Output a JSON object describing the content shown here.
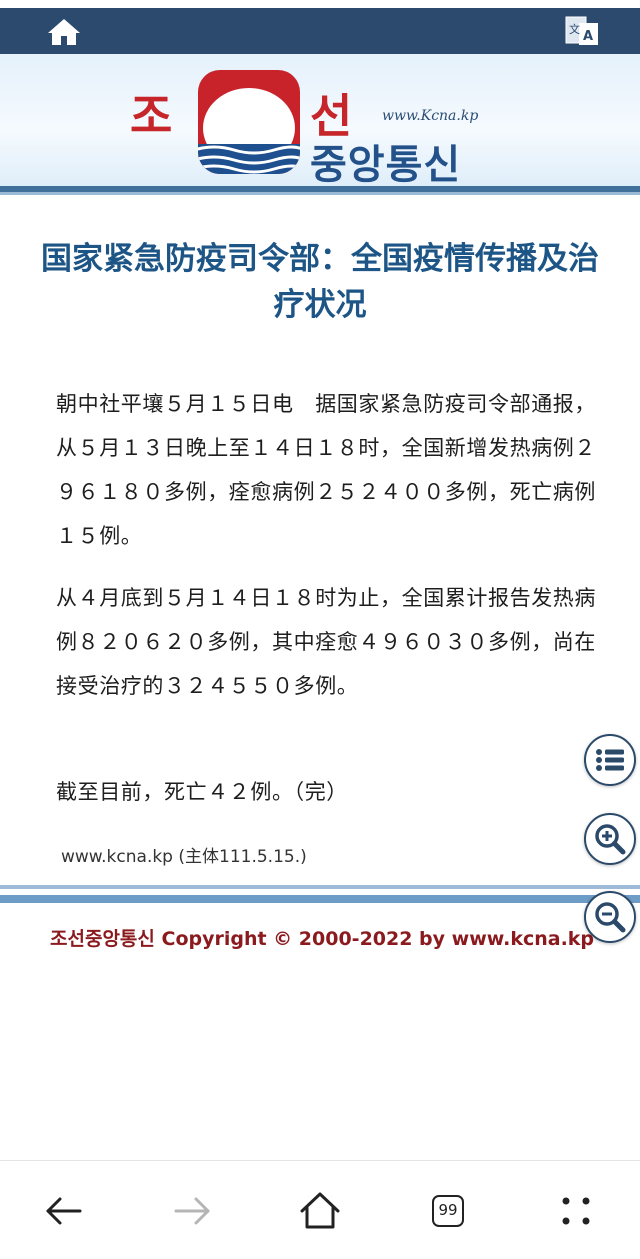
{
  "topbar": {
    "home_icon": "home-icon",
    "translate_icon": "translate-icon",
    "color": "#2c4a6e"
  },
  "banner": {
    "logo_top_left": "조",
    "logo_top_right": "선",
    "logo_url": "www.Kcna.kp",
    "logo_bottom": "중앙통신"
  },
  "article": {
    "title": "国家紧急防疫司令部：全国疫情传播及治疗状况",
    "paragraphs": [
      "朝中社平壤５月１５日电　据国家紧急防疫司令部通报，从５月１３日晚上至１４日１８时，全国新增发热病例２９６１８０多例，痊愈病例２５２４００多例，死亡病例１５例。",
      "从４月底到５月１４日１８时为止，全国累计报告发热病例８２０６２０多例，其中痊愈４９６０３０多例，尚在接受治疗的３２４５５０多例。",
      "截至目前，死亡４２例。（完）"
    ],
    "source": "www.kcna.kp (主体111.5.15.)"
  },
  "footer": {
    "copyright": "조선중앙통신 Copyright © 2000-2022 by www.kcna.kp"
  },
  "floating_buttons": {
    "list": "list-icon",
    "zoom_in": "zoom-in-icon",
    "zoom_out": "zoom-out-icon"
  },
  "bottom_nav": {
    "back": "back-arrow-icon",
    "forward": "forward-arrow-icon",
    "home": "home-icon",
    "tab_count": "99",
    "menu": "menu-dots-icon"
  },
  "colors": {
    "title": "#1c5586",
    "copyright": "#8b1a1e",
    "accent": "#2c4a6e"
  }
}
